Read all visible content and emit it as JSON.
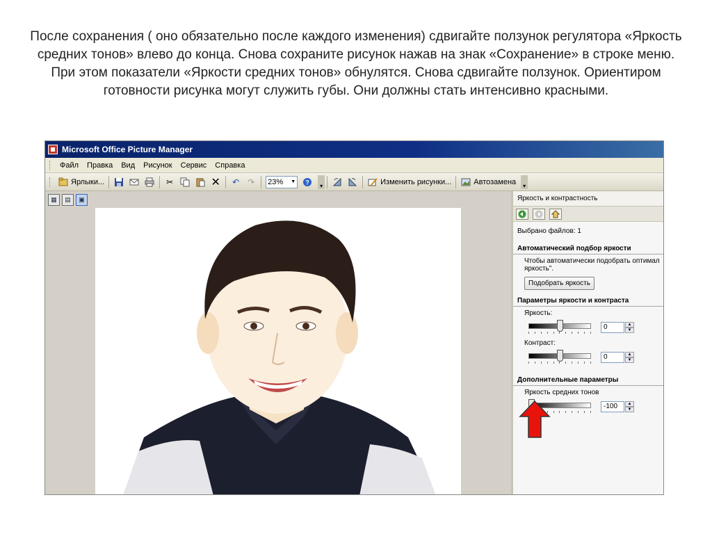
{
  "caption": "После сохранения ( оно обязательно после каждого изменения) сдвигайте ползунок регулятора «Яркость средних тонов» влево до конца.  Снова сохраните рисунок нажав на знак «Сохранение» в строке меню. При этом показатели «Яркости средних тонов» обнулятся. Снова сдвигайте ползунок. Ориентиром  готовности рисунка могут служить губы. Они должны стать интенсивно красными.",
  "window": {
    "title": "Microsoft Office Picture Manager"
  },
  "menu": [
    "Файл",
    "Правка",
    "Вид",
    "Рисунок",
    "Сервис",
    "Справка"
  ],
  "toolbar": {
    "shortcuts_label": "Ярлыки...",
    "zoom_value": "23%",
    "edit_pictures_label": "Изменить рисунки...",
    "autocorrect_label": "Автозамена"
  },
  "pane": {
    "title": "Яркость и контрастность",
    "selected_files": "Выбрано файлов: 1",
    "auto_section_title": "Автоматический подбор яркости",
    "auto_desc": "Чтобы автоматически подобрать оптимал яркость\".",
    "auto_button": "Подобрать яркость",
    "params_section_title": "Параметры яркости и контраста",
    "brightness_label": "Яркость:",
    "brightness_value": "0",
    "brightness_level": 0.5,
    "contrast_label": "Контраст:",
    "contrast_value": "0",
    "contrast_level": 0.5,
    "extra_section_title": "Дополнительные параметры",
    "midtone_label": "Яркость средних тонов",
    "midtone_value": "-100",
    "midtone_level": 0.0
  },
  "colors": {
    "arrow": "#e8140c",
    "titlebar": "#0a246a"
  }
}
